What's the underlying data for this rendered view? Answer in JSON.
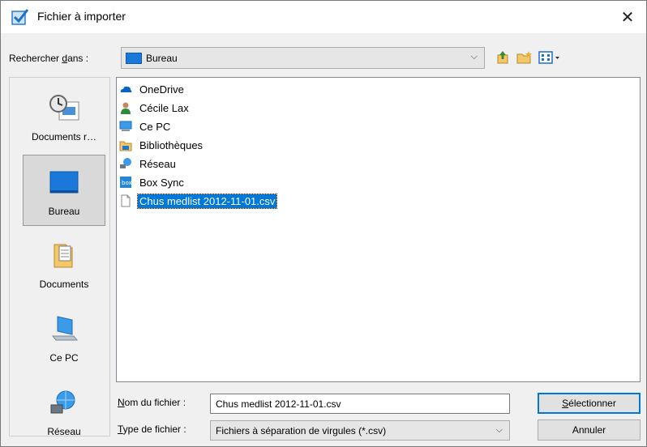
{
  "window": {
    "title": "Fichier à importer",
    "close_glyph": "✕"
  },
  "lookin": {
    "label_pre": "Rechercher ",
    "label_accel": "d",
    "label_post": "ans :",
    "value": "Bureau",
    "arrow": "⌵"
  },
  "places": [
    {
      "label": "Documents r…",
      "icon": "recent-documents-icon"
    },
    {
      "label": "Bureau",
      "icon": "desktop-icon"
    },
    {
      "label": "Documents",
      "icon": "documents-folder-icon"
    },
    {
      "label": "Ce PC",
      "icon": "computer-icon"
    },
    {
      "label": "Réseau",
      "icon": "network-icon"
    }
  ],
  "files": [
    {
      "name": "OneDrive",
      "icon": "onedrive-icon"
    },
    {
      "name": "Cécile Lax",
      "icon": "user-folder-icon"
    },
    {
      "name": "Ce PC",
      "icon": "computer-icon"
    },
    {
      "name": "Bibliothèques",
      "icon": "libraries-icon"
    },
    {
      "name": "Réseau",
      "icon": "network-icon"
    },
    {
      "name": "Box Sync",
      "icon": "box-sync-icon"
    },
    {
      "name": "Chus medlist 2012-11-01.csv",
      "icon": "csv-file-icon",
      "selected": true
    }
  ],
  "filename": {
    "label_accel": "N",
    "label_rest": "om du fichier :",
    "value": "Chus medlist 2012-11-01.csv"
  },
  "filetype": {
    "label_accel": "T",
    "label_rest": "ype de fichier :",
    "value": "Fichiers à séparation de virgules (*.csv)",
    "arrow": "⌵"
  },
  "buttons": {
    "select_accel": "S",
    "select_rest": "électionner",
    "cancel": "Annuler"
  },
  "colors": {
    "selection": "#0078d7",
    "folder_blue": "#1a78d8"
  }
}
